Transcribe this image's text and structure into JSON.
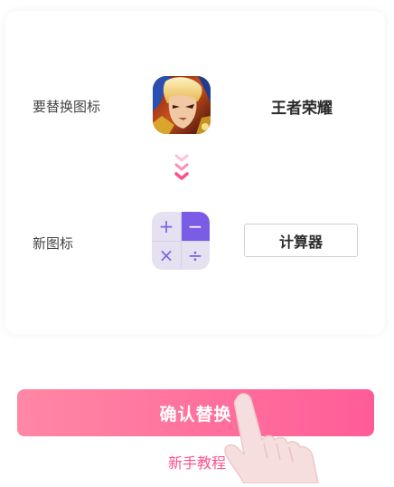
{
  "original": {
    "label": "要替换图标",
    "app_name": "王者荣耀",
    "icon": "game-hero-icon"
  },
  "replacement": {
    "label": "新图标",
    "icon": "calculator-icon",
    "name_value": "计算器",
    "calc_symbols": [
      "+",
      "−",
      "×",
      "÷"
    ]
  },
  "arrow_icon": "chevron-triple-down-icon",
  "confirm_label": "确认替换",
  "tutorial_label": "新手教程",
  "colors": {
    "accent_pink": "#ff5c97",
    "accent_purple": "#7b5ce6"
  }
}
